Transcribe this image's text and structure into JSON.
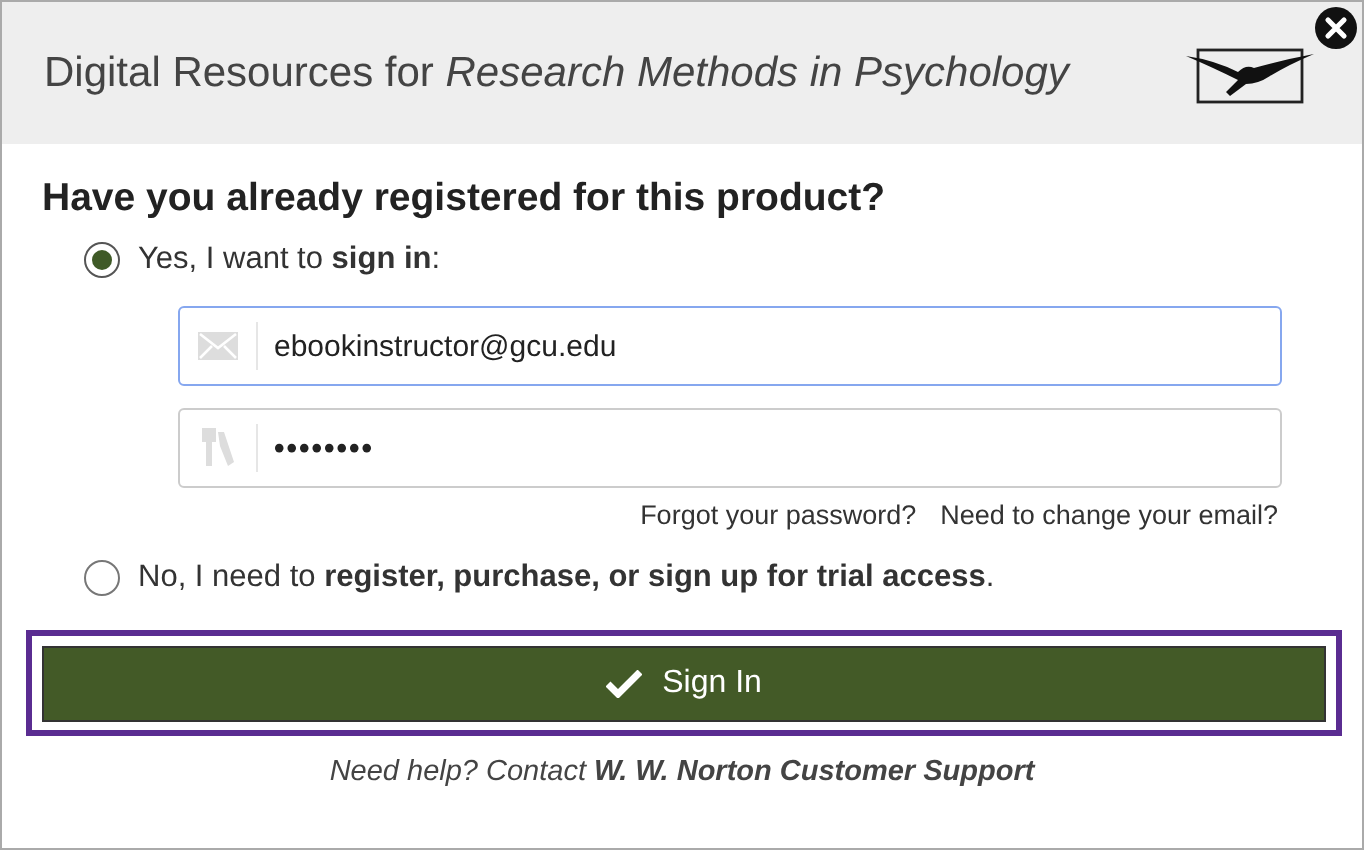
{
  "header": {
    "title": "Digital Resources for *Research Methods in Psychology*"
  },
  "question": "Have you already registered for this product?",
  "options": [
    {
      "label": "Yes, I want to **sign in**:",
      "selected": true
    },
    {
      "label": "No, I need to **register, purchase, or sign up for trial access**.",
      "selected": false
    }
  ],
  "fields": [
    {
      "kind": "email",
      "value": "ebookinstructor@gcu.edu",
      "focused": true
    },
    {
      "kind": "password",
      "value": "••••••••",
      "focused": false
    }
  ],
  "links": [
    "Forgot your password?",
    "Need to change your email?"
  ],
  "submit": {
    "label": "Sign In"
  },
  "footer": "Need help? Contact **W. W. Norton Customer Support**"
}
